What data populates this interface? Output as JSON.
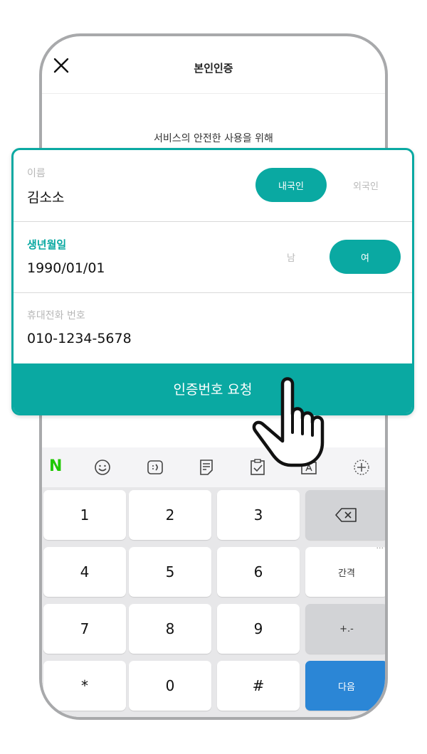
{
  "header": {
    "title": "본인인증",
    "close_icon": "close-icon"
  },
  "intro_text": "서비스의 안전한 사용을 위해",
  "form": {
    "name": {
      "label": "이름",
      "value": "김소소",
      "options": [
        "내국인",
        "외국인"
      ],
      "selected": "내국인"
    },
    "birth": {
      "label": "생년월일",
      "value": "1990/01/01",
      "options": [
        "남",
        "여"
      ],
      "selected": "여"
    },
    "phone": {
      "label": "휴대전화 번호",
      "value": "010-1234-5678"
    },
    "request_button": "인증번호 요청"
  },
  "keyboard": {
    "toolbar": {
      "logo": "N",
      "icons": [
        "emoji-icon",
        "emoticon-icon",
        "memo-icon",
        "clipboard-icon",
        "text-recognition-icon",
        "add-icon"
      ]
    },
    "keys": {
      "k1": "1",
      "k2": "2",
      "k3": "3",
      "k4": "4",
      "k5": "5",
      "k6": "6",
      "k7": "7",
      "k8": "8",
      "k9": "9",
      "star": "*",
      "k0": "0",
      "hash": "#",
      "space": "간격",
      "symbols": "+.-",
      "next": "다음",
      "more": "..."
    }
  },
  "colors": {
    "accent": "#0aa9a2",
    "next_key": "#2b86d6",
    "naver_green": "#1ec800"
  }
}
